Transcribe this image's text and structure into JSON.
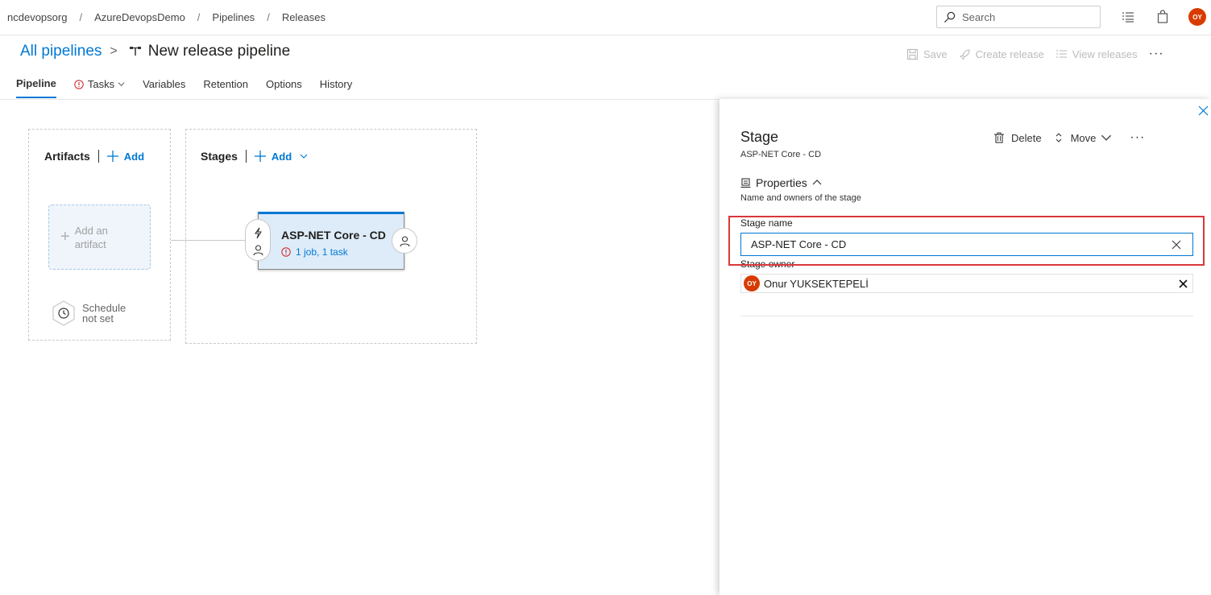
{
  "breadcrumb": [
    "ncdevopsorg",
    "AzureDevopsDemo",
    "Pipelines",
    "Releases"
  ],
  "search": {
    "placeholder": "Search"
  },
  "user": {
    "initials": "OY",
    "color": "#d83b01"
  },
  "title": {
    "all_pipelines": "All pipelines",
    "pipeline_name": "New release pipeline"
  },
  "toolbar": {
    "save": "Save",
    "create_release": "Create release",
    "view_releases": "View releases",
    "more": "···"
  },
  "tabs": [
    {
      "label": "Pipeline",
      "active": true
    },
    {
      "label": "Tasks",
      "warning": true,
      "dropdown": true
    },
    {
      "label": "Variables"
    },
    {
      "label": "Retention"
    },
    {
      "label": "Options"
    },
    {
      "label": "History"
    }
  ],
  "artifacts": {
    "label": "Artifacts",
    "add": "Add",
    "placeholder_line1": "Add an",
    "placeholder_line2": "artifact",
    "schedule_line1": "Schedule",
    "schedule_line2": "not set"
  },
  "stages": {
    "label": "Stages",
    "add": "Add",
    "card": {
      "name": "ASP-NET Core - CD",
      "summary": "1 job, 1 task"
    }
  },
  "panel": {
    "title": "Stage",
    "subtitle": "ASP-NET Core - CD",
    "delete": "Delete",
    "move": "Move",
    "more": "···",
    "properties": {
      "title": "Properties",
      "subtitle": "Name and owners of the stage"
    },
    "stage_name_label": "Stage name",
    "stage_name_value": "ASP-NET Core - CD",
    "stage_owner_label": "Stage owner",
    "owner": {
      "initials": "OY",
      "name": "Onur YUKSEKTEPELİ"
    }
  },
  "colors": {
    "accent": "#0078d4",
    "highlight": "#d9383a",
    "stage_bg": "#deecf9",
    "avatar": "#d83b01"
  }
}
